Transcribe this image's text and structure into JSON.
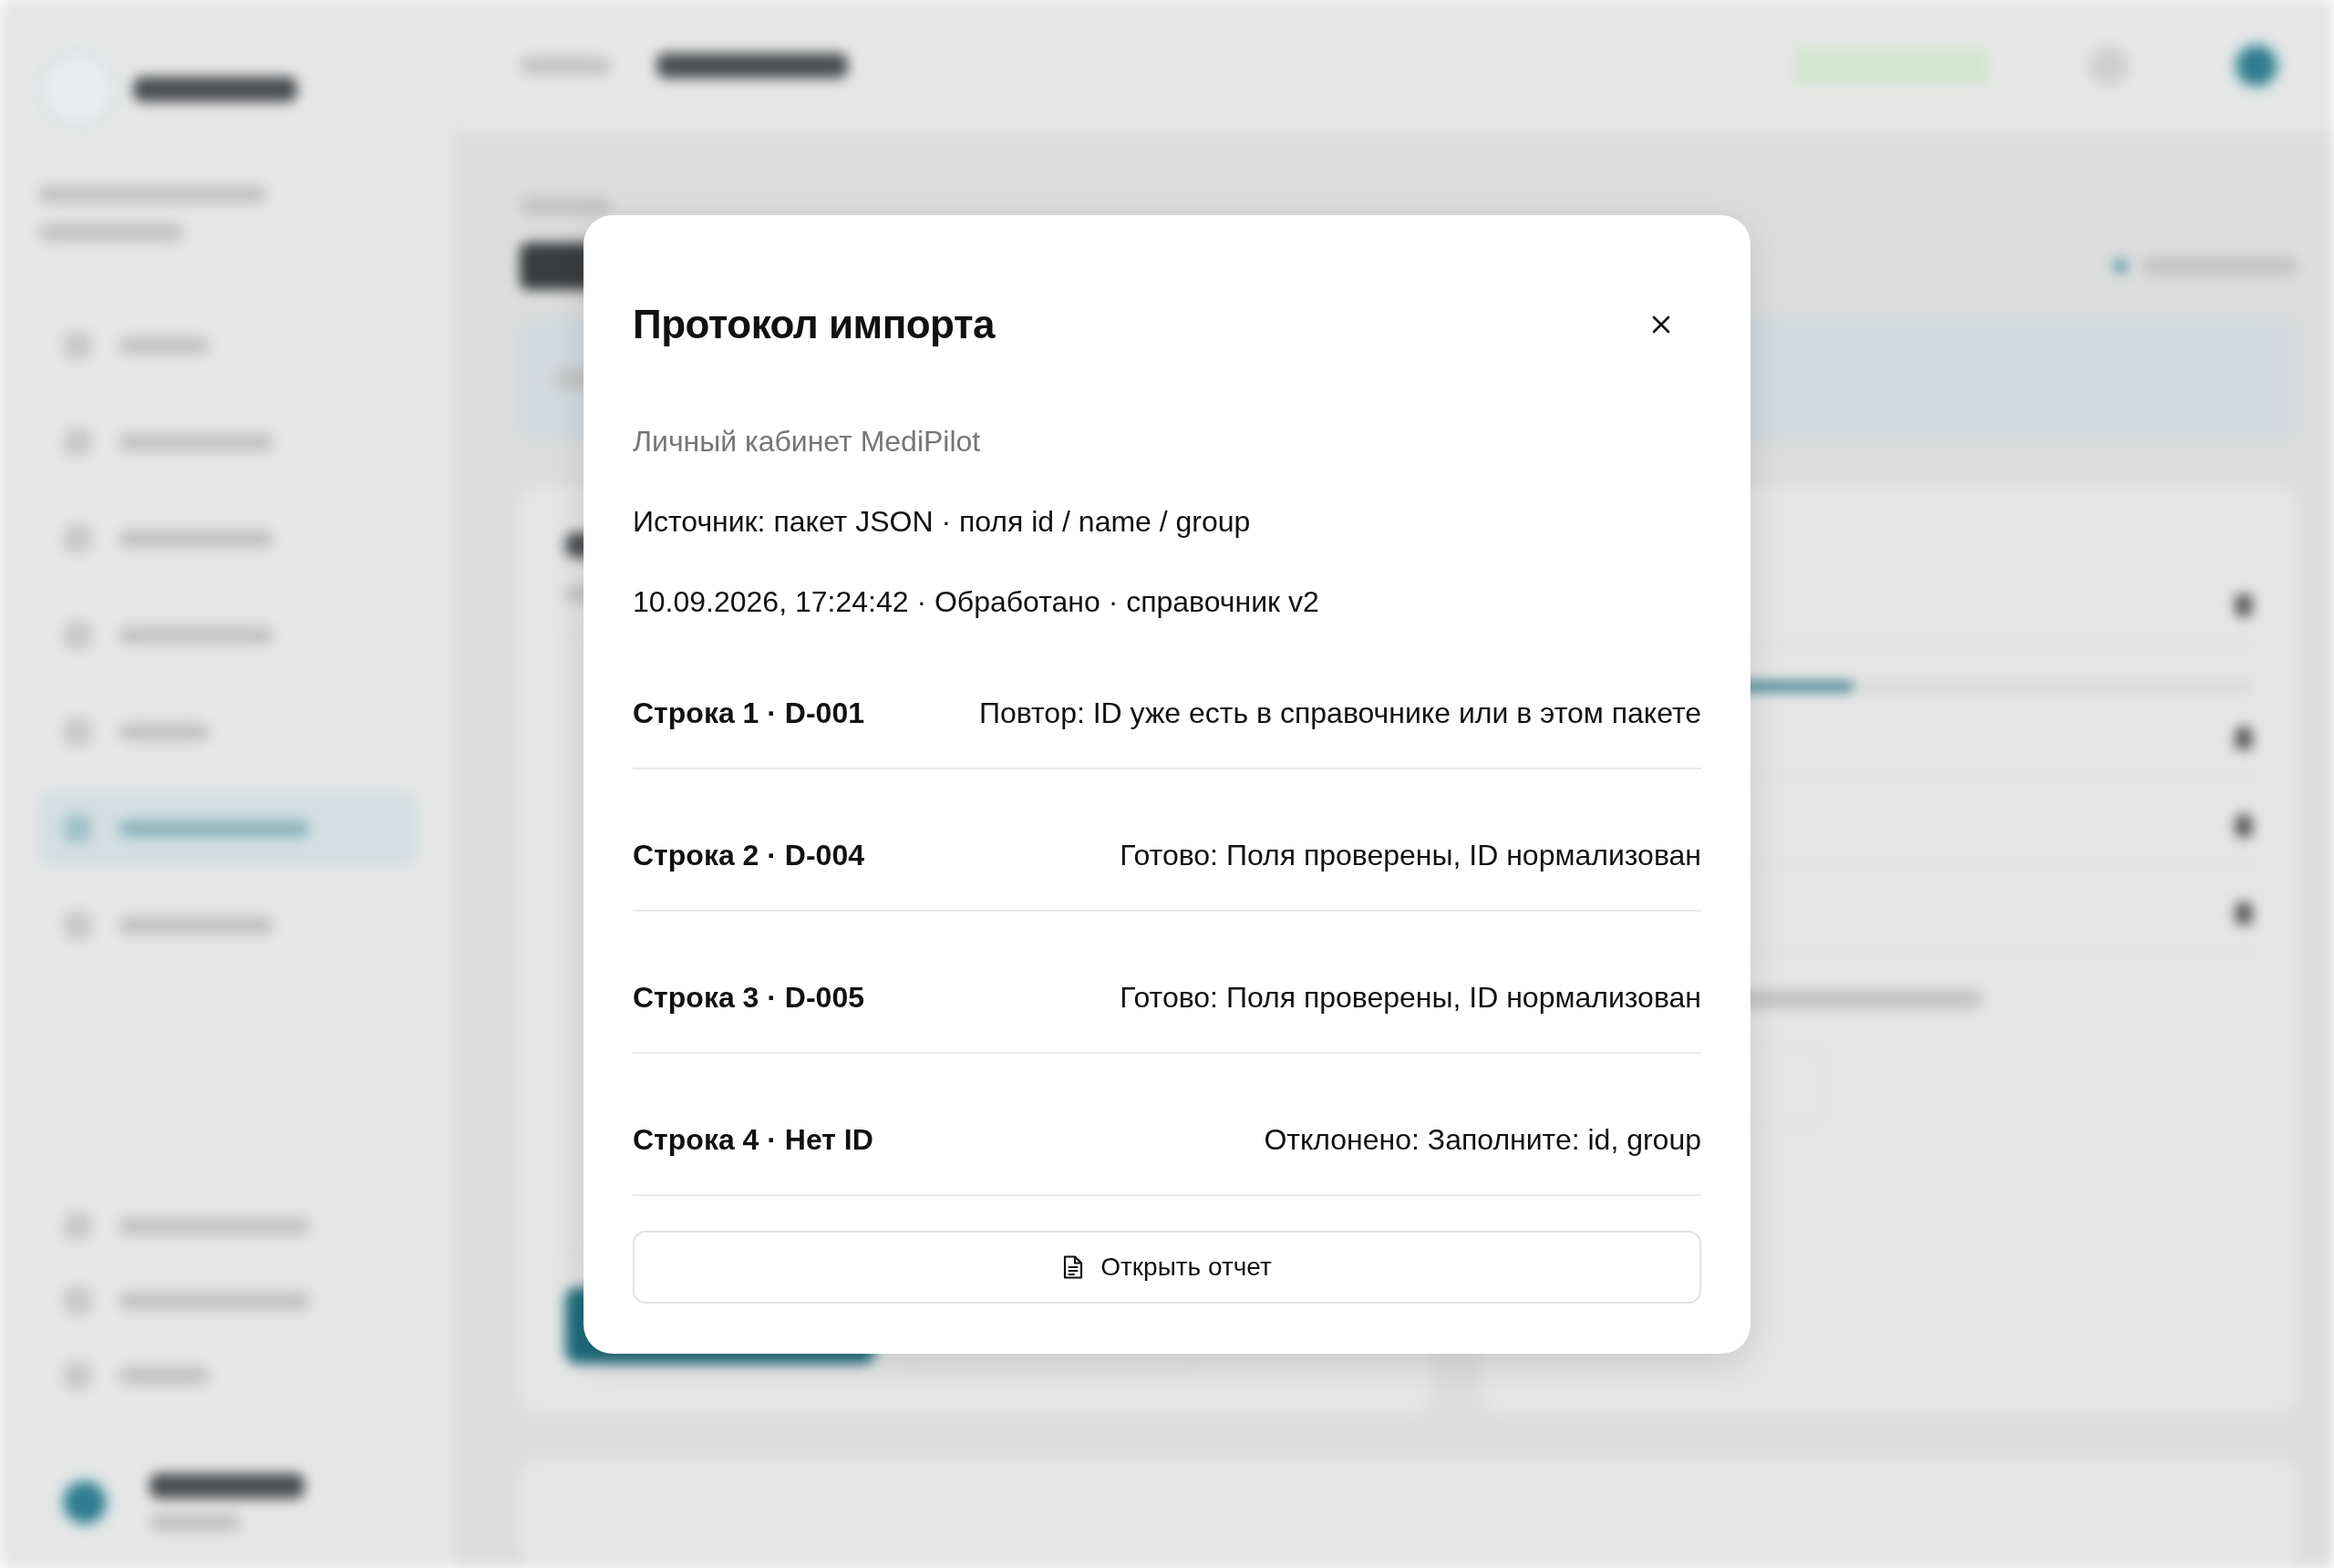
{
  "modal": {
    "title": "Протокол импорта",
    "subtitle": "Личный кабинет MediPilot",
    "details": [
      "Источник: пакет JSON · поля id / name / group",
      "10.09.2026, 17:24:42 · Обработано · справочник v2"
    ],
    "rows": [
      {
        "label": "Строка 1 · D-001",
        "message": "Повтор: ID уже есть в справочнике или в этом пакете"
      },
      {
        "label": "Строка 2 · D-004",
        "message": "Готово: Поля проверены, ID нормализован"
      },
      {
        "label": "Строка 3 · D-005",
        "message": "Готово: Поля проверены, ID нормализован"
      },
      {
        "label": "Строка 4 · Нет ID",
        "message": "Отклонено: Заполните: id, group"
      }
    ],
    "action": {
      "label": "Открыть отчет"
    }
  }
}
